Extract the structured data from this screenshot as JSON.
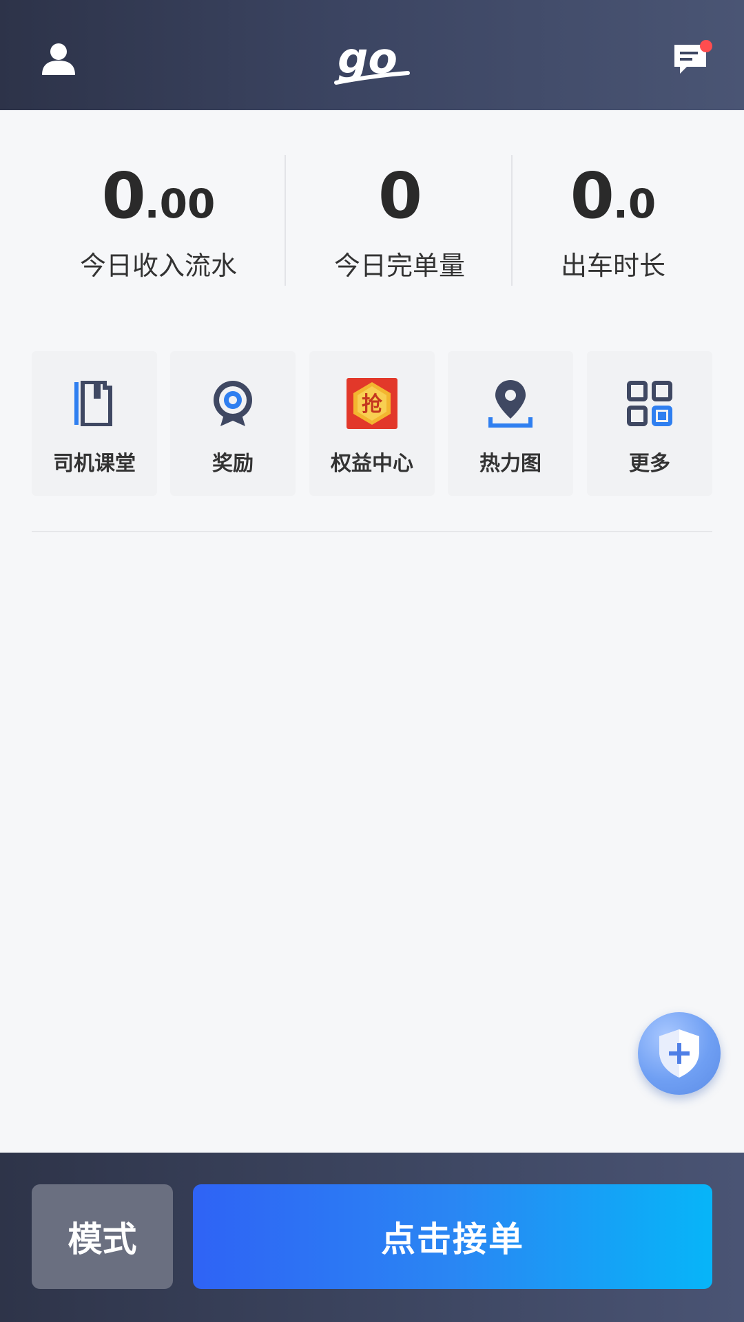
{
  "header": {
    "logo_text": "go",
    "has_unread_messages": true
  },
  "stats": [
    {
      "int": "0",
      "dec": ".00",
      "label": "今日收入流水"
    },
    {
      "int": "0",
      "dec": "",
      "label": "今日完单量"
    },
    {
      "int": "0",
      "dec": ".0",
      "label": "出车时长"
    }
  ],
  "tiles": [
    {
      "label": "司机课堂",
      "icon": "book-icon"
    },
    {
      "label": "奖励",
      "icon": "medal-icon"
    },
    {
      "label": "权益中心",
      "icon": "grab-badge-icon",
      "icon_text": "抢"
    },
    {
      "label": "热力图",
      "icon": "location-pin-icon"
    },
    {
      "label": "更多",
      "icon": "grid-icon"
    }
  ],
  "bottom": {
    "mode_label": "模式",
    "accept_label": "点击接单"
  },
  "colors": {
    "header_bg": "#3b4461",
    "accent_blue": "#2a86f3",
    "badge_red": "#ff4d4f"
  }
}
